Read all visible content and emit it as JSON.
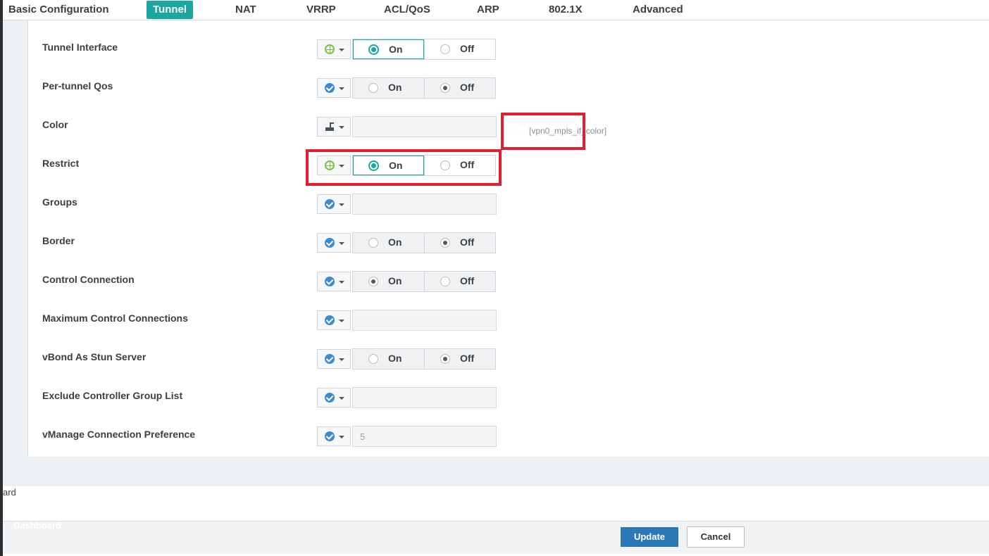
{
  "tabs": [
    {
      "label": "Basic Configuration"
    },
    {
      "label": "Tunnel"
    },
    {
      "label": "NAT"
    },
    {
      "label": "VRRP"
    },
    {
      "label": "ACL/QoS"
    },
    {
      "label": "ARP"
    },
    {
      "label": "802.1X"
    },
    {
      "label": "Advanced"
    }
  ],
  "active_tab": "Tunnel",
  "fields": [
    {
      "label": "Tunnel Interface",
      "scope_icon": "globe-icon",
      "type": "toggle",
      "value": "On",
      "on_label": "On",
      "off_label": "Off"
    },
    {
      "label": "Per-tunnel Qos",
      "scope_icon": "check-circle-icon",
      "type": "toggle",
      "value": "Off",
      "on_label": "On",
      "off_label": "Off"
    },
    {
      "label": "Color",
      "scope_icon": "device-icon",
      "type": "text",
      "value": "",
      "variable": "[vpn0_mpls_if_color]"
    },
    {
      "label": "Restrict",
      "scope_icon": "globe-icon",
      "type": "toggle",
      "value": "On",
      "on_label": "On",
      "off_label": "Off"
    },
    {
      "label": "Groups",
      "scope_icon": "check-circle-icon",
      "type": "text",
      "value": ""
    },
    {
      "label": "Border",
      "scope_icon": "check-circle-icon",
      "type": "toggle",
      "value": "Off",
      "on_label": "On",
      "off_label": "Off"
    },
    {
      "label": "Control Connection",
      "scope_icon": "check-circle-icon",
      "type": "toggle",
      "value": "On",
      "on_label": "On",
      "off_label": "Off"
    },
    {
      "label": "Maximum Control Connections",
      "scope_icon": "check-circle-icon",
      "type": "text",
      "value": ""
    },
    {
      "label": "vBond As Stun Server",
      "scope_icon": "check-circle-icon",
      "type": "toggle",
      "value": "Off",
      "on_label": "On",
      "off_label": "Off"
    },
    {
      "label": "Exclude Controller Group List",
      "scope_icon": "check-circle-icon",
      "type": "text",
      "value": ""
    },
    {
      "label": "vManage Connection Preference",
      "scope_icon": "check-circle-icon",
      "type": "text",
      "value": "5"
    }
  ],
  "sidebar_fragment": "ard",
  "sidebar_dashboard": "Dashboard",
  "buttons": {
    "update": "Update",
    "cancel": "Cancel"
  },
  "colors": {
    "accent": "#19a7a0",
    "primary_button": "#2b78b8",
    "highlight": "#e02030"
  }
}
